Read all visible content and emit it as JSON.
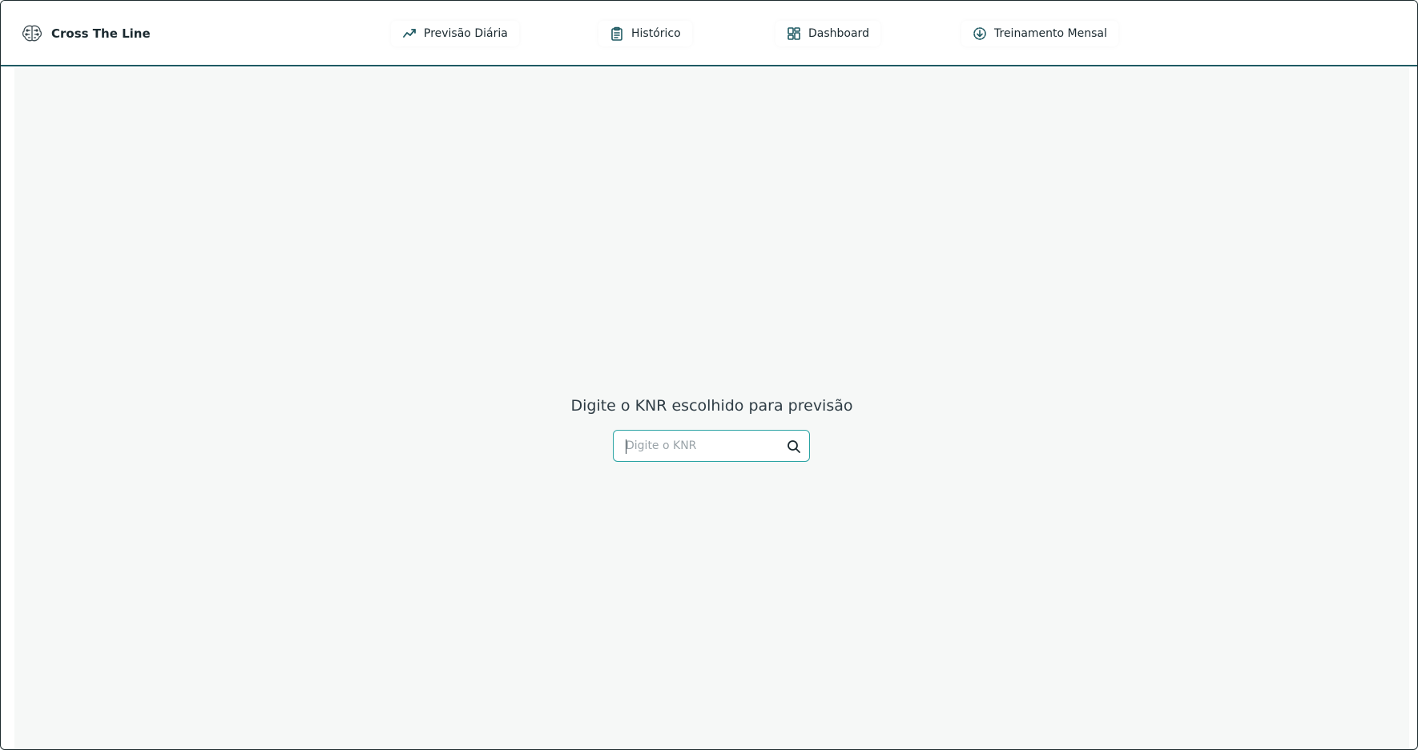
{
  "app": {
    "name": "Cross The Line",
    "logo_icon": "brain-circuit-icon"
  },
  "nav": {
    "items": [
      {
        "label": "Previsão Diária",
        "icon": "trending-up-icon"
      },
      {
        "label": "Histórico",
        "icon": "clipboard-list-icon"
      },
      {
        "label": "Dashboard",
        "icon": "dashboard-grid-icon"
      },
      {
        "label": "Treinamento Mensal",
        "icon": "circle-download-icon"
      }
    ]
  },
  "main": {
    "prompt": "Digite o KNR escolhido para previsão",
    "search": {
      "placeholder": "Digite o KNR",
      "value": ""
    }
  },
  "colors": {
    "accent": "#1f5a63",
    "input_border": "#2aa3a3",
    "background": "#f6f8f7",
    "text": "#1b2a30"
  }
}
